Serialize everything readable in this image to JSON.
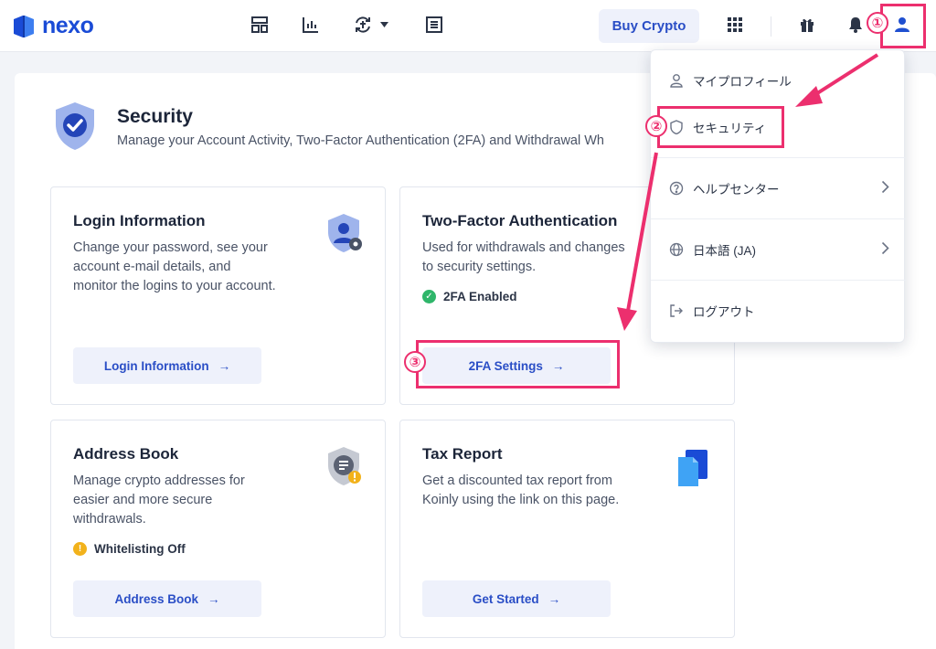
{
  "brand": {
    "name": "nexo"
  },
  "topbar": {
    "buy_label": "Buy Crypto",
    "icons": [
      "dashboard-icon",
      "chart-icon",
      "exchange-icon",
      "list-icon",
      "apps-grid-icon",
      "gift-icon",
      "bell-icon",
      "user-icon"
    ]
  },
  "security": {
    "title": "Security",
    "subtitle": "Manage your Account Activity, Two-Factor Authentication (2FA) and Withdrawal Wh"
  },
  "cards": {
    "login": {
      "title": "Login Information",
      "desc": [
        "Change your password, see your",
        "account e-mail details, and",
        "monitor the logins to your account."
      ],
      "button": "Login Information"
    },
    "twofa": {
      "title": "Two-Factor Authentication",
      "desc": [
        "Used for withdrawals and changes",
        "to security settings."
      ],
      "status": "2FA Enabled",
      "button": "2FA Settings"
    },
    "address": {
      "title": "Address Book",
      "desc": [
        "Manage crypto addresses for",
        "easier and more secure",
        "withdrawals."
      ],
      "status": "Whitelisting Off",
      "button": "Address Book"
    },
    "tax": {
      "title": "Tax Report",
      "desc": [
        "Get a discounted tax report from",
        "Koinly using the link on this page."
      ],
      "button": "Get Started"
    }
  },
  "menu": {
    "items": [
      {
        "label": "マイプロフィール",
        "icon": "user-outline-icon"
      },
      {
        "label": "セキュリティ",
        "icon": "shield-outline-icon"
      },
      {
        "label": "ヘルプセンター",
        "icon": "help-circle-icon"
      },
      {
        "label": "日本語 (JA)",
        "icon": "globe-icon"
      },
      {
        "label": "ログアウト",
        "icon": "logout-icon"
      }
    ]
  },
  "annotations": {
    "n1": "①",
    "n2": "②",
    "n3": "③"
  },
  "colors": {
    "accent": "#2a4ec6",
    "highlight": "#ec2f6e",
    "success": "#2fb66a",
    "warning": "#f2b21b",
    "brand": "#1a4bd6"
  }
}
